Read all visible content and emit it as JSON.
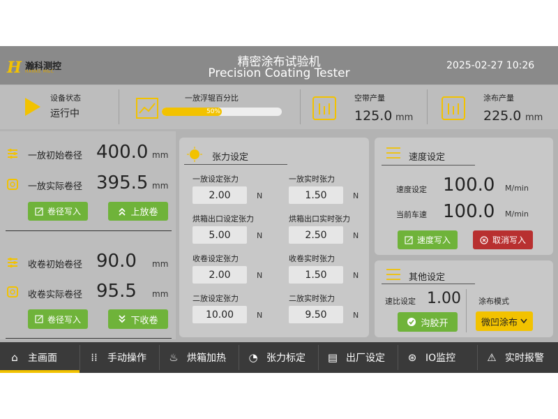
{
  "header": {
    "logo_cn": "瀚科测控",
    "logo_en": "HANKE M&C",
    "title_cn": "精密涂布试验机",
    "title_en": "Precision Coating Tester",
    "datetime": "2025-02-27 10:26"
  },
  "status": {
    "device_state_label": "设备状态",
    "device_state_value": "运行中",
    "float_roller_label": "一放浮辊百分比",
    "float_roller_value": "50%",
    "float_roller_fraction": 0.5,
    "empty_output_label": "空带产量",
    "empty_output_value": "125.0",
    "empty_output_unit": "mm",
    "coat_output_label": "涂布产量",
    "coat_output_value": "225.0",
    "coat_output_unit": "mm"
  },
  "unwind": {
    "init_label": "一放初始卷径",
    "init_value": "400.0",
    "actual_label": "一放实际卷径",
    "actual_value": "395.5",
    "unit": "mm",
    "write_btn": "卷径写入",
    "load_btn": "上放卷"
  },
  "rewind": {
    "init_label": "收卷初始卷径",
    "init_value": "90.0",
    "actual_label": "收卷实际卷径",
    "actual_value": "95.5",
    "unit": "mm",
    "write_btn": "卷径写入",
    "unload_btn": "下收卷"
  },
  "tension": {
    "title": "张力设定",
    "unit": "N",
    "items": [
      {
        "label": "一放设定张力",
        "value": "2.00"
      },
      {
        "label": "一放实时张力",
        "value": "1.50"
      },
      {
        "label": "烘箱出口设定张力",
        "value": "5.00"
      },
      {
        "label": "烘箱出口实时张力",
        "value": "2.50"
      },
      {
        "label": "收卷设定张力",
        "value": "2.00"
      },
      {
        "label": "收卷实时张力",
        "value": "1.50"
      },
      {
        "label": "二放设定张力",
        "value": "10.00"
      },
      {
        "label": "二放实时张力",
        "value": "9.50"
      }
    ]
  },
  "speed": {
    "title": "速度设定",
    "set_label": "速度设定",
    "set_value": "100.0",
    "current_label": "当前车速",
    "current_value": "100.0",
    "unit": "M/min",
    "write_btn": "速度写入",
    "cancel_btn": "取消写入"
  },
  "other": {
    "title": "其他设定",
    "ratio_label": "速比设定",
    "ratio_value": "1.00",
    "mode_label": "涂布模式",
    "mode_value": "微凹涂布",
    "glue_btn": "沟胶开"
  },
  "nav": {
    "items": [
      {
        "label": "主画面",
        "icon": "home-icon"
      },
      {
        "label": "手动操作",
        "icon": "manual-icon"
      },
      {
        "label": "烘箱加热",
        "icon": "heat-icon"
      },
      {
        "label": "张力标定",
        "icon": "calibrate-icon"
      },
      {
        "label": "出厂设定",
        "icon": "factory-icon"
      },
      {
        "label": "IO监控",
        "icon": "io-icon"
      },
      {
        "label": "实时报警",
        "icon": "alarm-icon"
      }
    ]
  },
  "colors": {
    "accent": "#f2c200",
    "green": "#6fb33a",
    "red": "#b83030",
    "nav_bg": "#3a3a3a"
  }
}
